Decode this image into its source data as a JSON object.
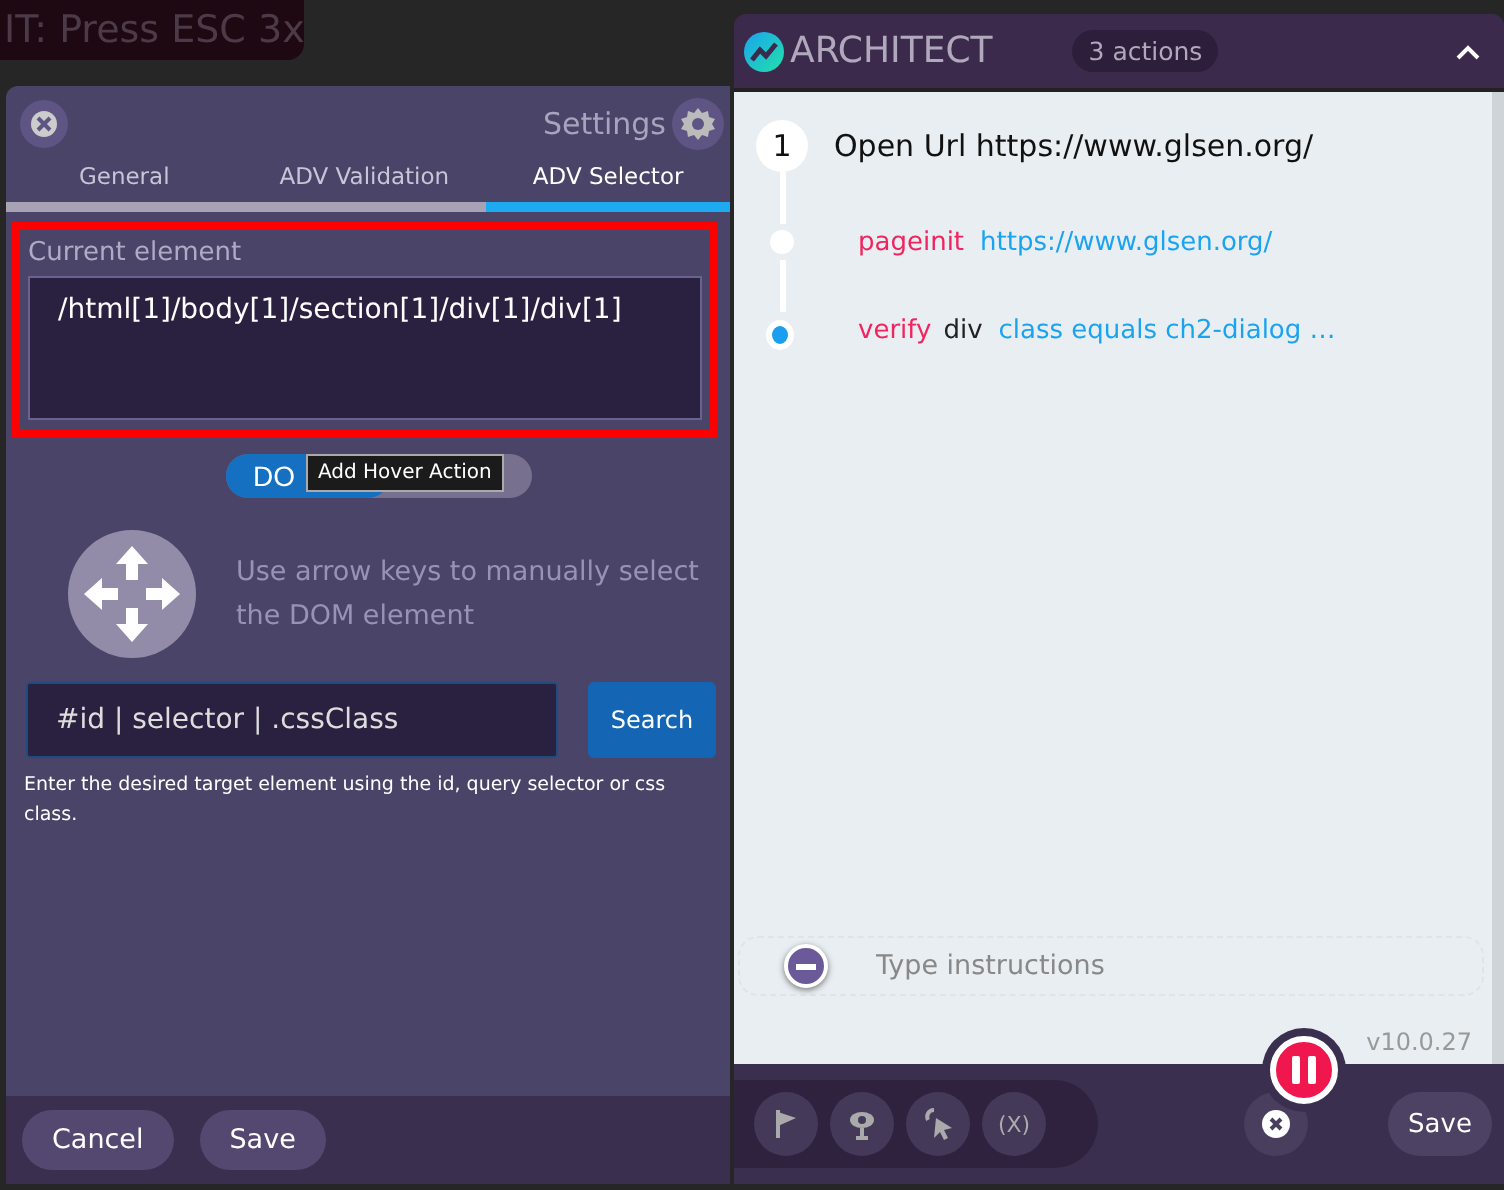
{
  "banner": {
    "text": "IT: Press ESC 3x"
  },
  "settings": {
    "title": "Settings",
    "tabs": [
      {
        "label": "General",
        "selected": false
      },
      {
        "label": "ADV Validation",
        "selected": false
      },
      {
        "label": "ADV Selector",
        "selected": true
      }
    ],
    "current_element": {
      "label": "Current element",
      "value": "/html[1]/body[1]/section[1]/div[1]/div[1]",
      "highlighted": true
    },
    "toggle": {
      "label": "DO",
      "on": true
    },
    "tooltip": "Add Hover Action",
    "arrow_hint": "Use arrow keys to manually select the DOM element",
    "search": {
      "placeholder": "#id | selector | .cssClass",
      "button": "Search"
    },
    "search_help": "Enter the desired target element using the id, query selector or css class.",
    "footer_buttons": [
      "Cancel",
      "Save"
    ]
  },
  "architect": {
    "title": "ARCHITECT",
    "badge": "3 actions",
    "steps": [
      {
        "number": "1",
        "title": "Open Url https://www.glsen.org/",
        "actions": [
          {
            "verb": "pageinit",
            "detail": "https://www.glsen.org/",
            "current": false
          },
          {
            "verb": "verify",
            "target": "div",
            "detail": "class equals ch2-dialog …",
            "current": true
          }
        ]
      }
    ],
    "instructions": {
      "placeholder": "Type instructions"
    },
    "version": "v10.0.27",
    "tools": [
      {
        "kind": "flag"
      },
      {
        "kind": "eye"
      },
      {
        "kind": "pointer"
      },
      {
        "kind": "text",
        "label": "(X)"
      }
    ],
    "save": "Save"
  }
}
